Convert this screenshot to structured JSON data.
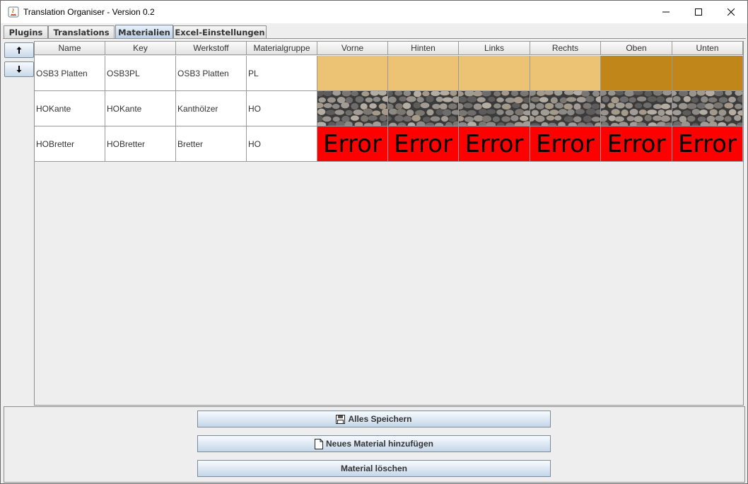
{
  "window": {
    "title": "Translation Organiser - Version 0.2",
    "icons": [
      "java-app-icon",
      "minimize-icon",
      "maximize-icon",
      "close-icon"
    ]
  },
  "tabs": [
    {
      "label": "Plugins",
      "selected": false
    },
    {
      "label": "Translations",
      "selected": false
    },
    {
      "label": "Materialien",
      "selected": true
    },
    {
      "label": "Excel-Einstellungen",
      "selected": false
    }
  ],
  "side_buttons": {
    "up_label": "🡑",
    "down_label": "🡓"
  },
  "table": {
    "columns": [
      "Name",
      "Key",
      "Werkstoff",
      "Materialgruppe",
      "Vorne",
      "Hinten",
      "Links",
      "Rechts",
      "Oben",
      "Unten"
    ],
    "rows": [
      {
        "name": "OSB3 Platten",
        "key": "OSB3PL",
        "werkstoff": "OSB3 Platten",
        "materialgruppe": "PL",
        "textures": [
          "osb-light",
          "osb-light",
          "osb-light",
          "osb-light",
          "osb-dark",
          "osb-dark"
        ]
      },
      {
        "name": "HOKante",
        "key": "HOKante",
        "werkstoff": "Kanthölzer",
        "materialgruppe": "HO",
        "textures": [
          "stone",
          "stone",
          "stone",
          "stone",
          "stone",
          "stone"
        ]
      },
      {
        "name": "HOBretter",
        "key": "HOBretter",
        "werkstoff": "Bretter",
        "materialgruppe": "HO",
        "textures": [
          "error",
          "error",
          "error",
          "error",
          "error",
          "error"
        ],
        "error_text": "Error"
      }
    ]
  },
  "colors": {
    "osb_light": "#ecc275",
    "osb_dark": "#c0861a",
    "error": "#ff0000"
  },
  "actions": {
    "save_label": "Alles Speichern",
    "new_label": "Neues Material hinzufügen",
    "delete_label": "Material löschen"
  }
}
